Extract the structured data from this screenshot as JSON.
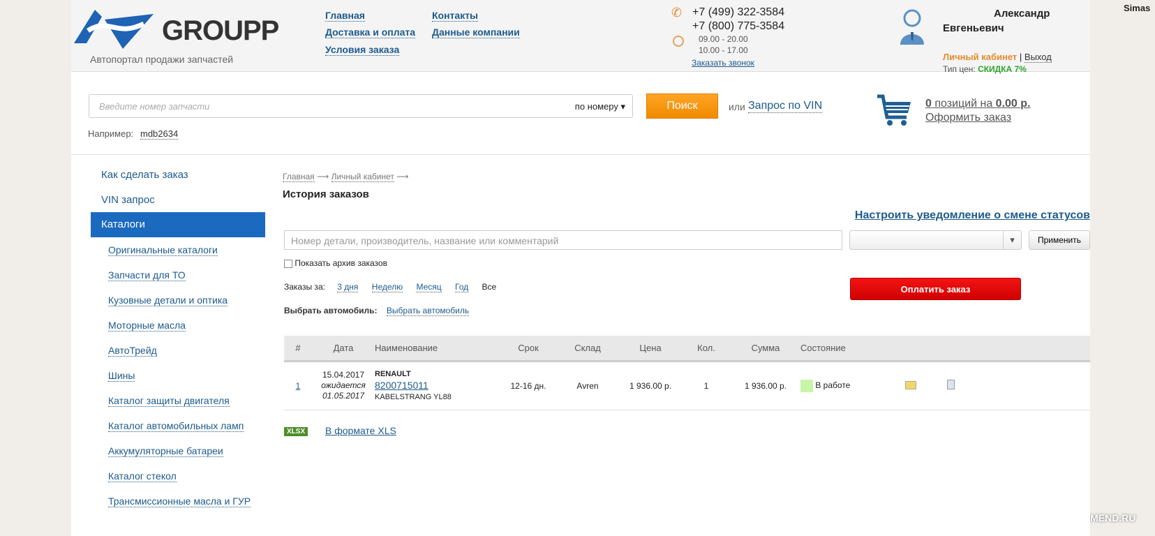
{
  "overlay_user": "Simas",
  "watermark": "RECOMMEND.RU",
  "header": {
    "logo_text": "GROUPP",
    "tagline": "Автопортал продажи запчастей",
    "nav": [
      "Главная",
      "Контакты",
      "Доставка и оплата",
      "Данные компании",
      "Условия заказа"
    ],
    "phones": [
      "+7 (499) 322-3584",
      "+7 (800) 775-3584"
    ],
    "hours": [
      "09.00 - 20.00",
      "10.00 - 17.00"
    ],
    "callback": "Заказать звонок",
    "user": {
      "first": "Александр",
      "middle": "Евгеньевич",
      "cabinet": "Личный кабинет",
      "sep": "|",
      "logout": "Выход",
      "price_label": "Тип цен:",
      "price_type": "СКИДКА 7%"
    }
  },
  "search": {
    "placeholder": "Введите номер запчасти",
    "mode": "по номеру",
    "button": "Поиск",
    "or": "или",
    "vin": "Запрос по VIN",
    "example_label": "Например:",
    "example": "mdb2634"
  },
  "cart": {
    "count": "0",
    "mid": " позиций на ",
    "sum": "0.00 р.",
    "checkout": "Оформить заказ"
  },
  "sidebar": {
    "items": [
      "Как сделать заказ",
      "VIN запрос",
      "Каталоги"
    ],
    "sub": [
      "Оригинальные каталоги",
      "Запчасти для ТО",
      "Кузовные детали и оптика",
      "Моторные масла",
      "АвтоТрейд",
      "Шины",
      "Каталог защиты двигателя",
      "Каталог автомобильных ламп",
      "Аккумуляторные батареи",
      "Каталог стекол",
      "Трансмиссионные масла и ГУР"
    ]
  },
  "main": {
    "breadcrumb": [
      "Главная",
      "Личный кабинет"
    ],
    "title": "История заказов",
    "notify": "Настроить уведомление о смене статусов",
    "filter_placeholder": "Номер детали, производитель, название или комментарий",
    "status_select": "",
    "apply": "Применить",
    "archive": "Показать архив заказов",
    "period_label": "Заказы за:",
    "periods": [
      "3 дня",
      "Неделю",
      "Месяц",
      "Год",
      "Все"
    ],
    "pay": "Оплатить заказ",
    "car_label": "Выбрать автомобиль:",
    "car_link": "Выбрать автомобиль",
    "columns": [
      "#",
      "Дата",
      "Наименование",
      "Срок",
      "Склад",
      "Цена",
      "Кол.",
      "Сумма",
      "Состояние"
    ],
    "rows": [
      {
        "num": "1",
        "date": "15.04.2017",
        "expected": "ожидается",
        "expected_date": "01.05.2017",
        "brand": "RENAULT",
        "part": "8200715011",
        "desc": "KABELSTRANG YL88",
        "term": "12-16 дн.",
        "stock": "Avren",
        "price": "1 936.00 р.",
        "qty": "1",
        "sum": "1 936.00 р.",
        "status": "В работе",
        "status_color": "#c6f5a6"
      }
    ],
    "xlsx_badge": "XLSX",
    "xls": "В формате XLS"
  }
}
